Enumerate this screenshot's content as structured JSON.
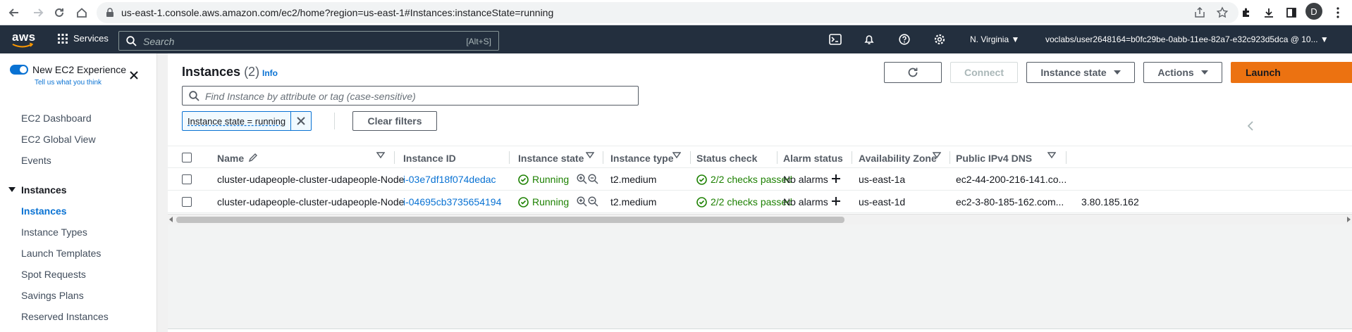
{
  "browser": {
    "url": "us-east-1.console.aws.amazon.com/ec2/home?region=us-east-1#Instances:instanceState=running",
    "profile_initial": "D"
  },
  "aws_nav": {
    "logo": "aws",
    "services_label": "Services",
    "search_placeholder": "Search",
    "search_shortcut": "[Alt+S]",
    "region": "N. Virginia ▼",
    "account": "voclabs/user2648164=b0fc29be-0abb-11ee-82a7-e32c923d5dca @ 10... ▼",
    "bg_color": "#232f3e"
  },
  "sidebar": {
    "experience_title": "New EC2 Experience",
    "experience_link": "Tell us what you think",
    "items": [
      {
        "label": "EC2 Dashboard"
      },
      {
        "label": "EC2 Global View"
      },
      {
        "label": "Events"
      }
    ],
    "group": {
      "label": "Instances",
      "items": [
        {
          "label": "Instances",
          "active": true
        },
        {
          "label": "Instance Types"
        },
        {
          "label": "Launch Templates"
        },
        {
          "label": "Spot Requests"
        },
        {
          "label": "Savings Plans"
        },
        {
          "label": "Reserved Instances"
        }
      ]
    }
  },
  "main": {
    "title": "Instances",
    "count": "(2)",
    "info": "Info",
    "buttons": {
      "connect": "Connect",
      "instance_state": "Instance state",
      "actions": "Actions",
      "launch": "Launch"
    },
    "filter_placeholder": "Find Instance by attribute or tag (case-sensitive)",
    "filter_token": "Instance state = running",
    "clear_filters": "Clear filters",
    "accent_color": "#ec7211",
    "link_color": "#0972d3"
  },
  "table": {
    "columns": [
      "Name",
      "Instance ID",
      "Instance state",
      "Instance type",
      "Status check",
      "Alarm status",
      "Availability Zone",
      "Public IPv4 DNS"
    ],
    "rows": [
      {
        "name": "cluster-udapeople-cluster-udapeople-Node",
        "instance_id": "i-03e7df18f074dedac",
        "state": "Running",
        "type": "t2.medium",
        "status_check": "2/2 checks passed",
        "alarm": "No alarms",
        "az": "us-east-1a",
        "dns": "ec2-44-200-216-141.co...",
        "ip": ""
      },
      {
        "name": "cluster-udapeople-cluster-udapeople-Node",
        "instance_id": "i-04695cb3735654194",
        "state": "Running",
        "type": "t2.medium",
        "status_check": "2/2 checks passed",
        "alarm": "No alarms",
        "az": "us-east-1d",
        "dns": "ec2-3-80-185-162.com...",
        "ip": "3.80.185.162"
      }
    ]
  }
}
